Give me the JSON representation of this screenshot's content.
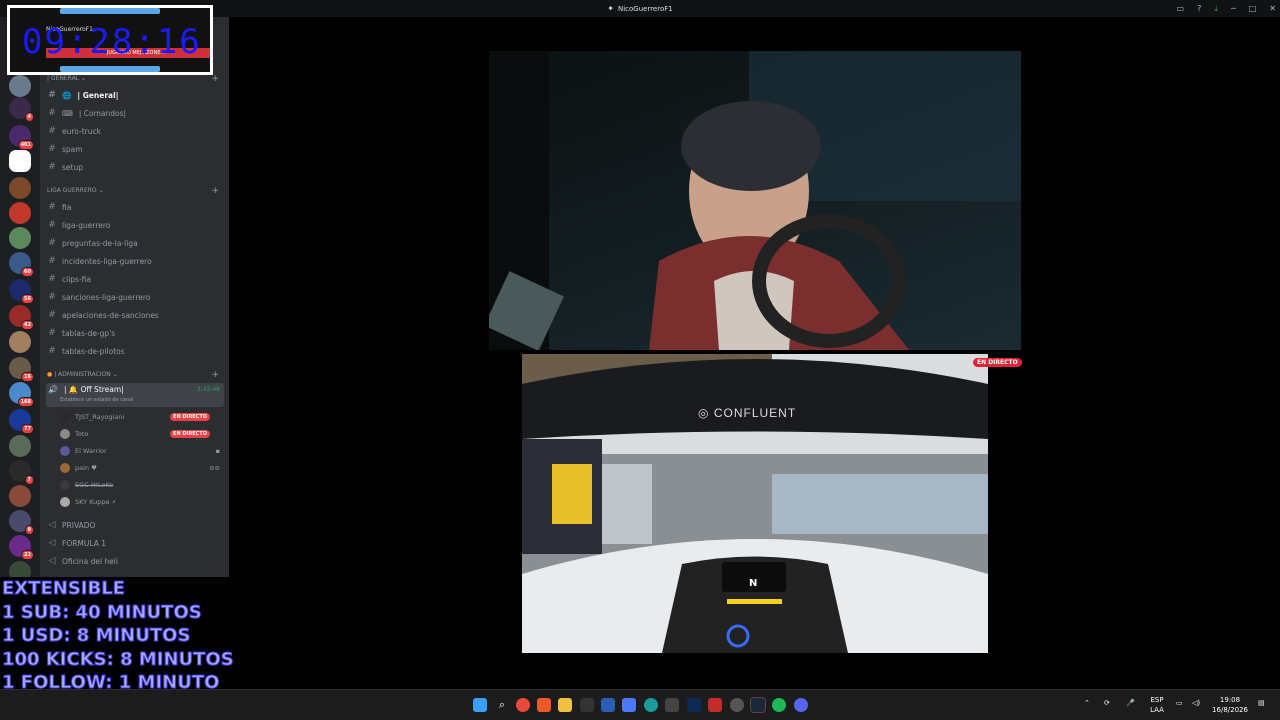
{
  "window": {
    "title": "NicoGuerreroF1"
  },
  "timer": {
    "value": "09:28:16",
    "server_name": "NicoGuerreroF1",
    "subtitle": "JUGANDO MEJ...ZONE..."
  },
  "server_badges": [
    "4",
    "401",
    "60",
    "56",
    "42",
    "16",
    "168",
    "77",
    "7",
    "9",
    "22"
  ],
  "categories": {
    "general": "| GENERAL",
    "liga": "LIGA GUERRERO",
    "admin": "| ADMINISTRACION"
  },
  "channels": {
    "general": [
      "| General|",
      "| Comandos|",
      "euro-truck",
      "spam",
      "setup"
    ],
    "liga": [
      "fia",
      "liga-guerrero",
      "preguntas-de-la-liga",
      "incidentes-liga-guerrero",
      "clips-fia",
      "sanciones-liga-guerrero",
      "apelaciones-de-sanciones",
      "tablas-de-gp's",
      "tablas-de-pilotos"
    ]
  },
  "voice": {
    "name": "| 🔔 Off Stream|",
    "duration": "3:43:48",
    "status": "Establece un estado de canal",
    "users": [
      {
        "name": "TJST_Rayogiani",
        "live": "EN DIRECTO"
      },
      {
        "name": "Toto",
        "live": "EN DIRECTO"
      },
      {
        "name": "El Warrior",
        "live": ""
      },
      {
        "name": "pain ♥",
        "live": ""
      },
      {
        "name": "SGC-HILoKo",
        "live": ""
      },
      {
        "name": "SKY Kuppe ⚡",
        "live": ""
      }
    ]
  },
  "voice_channels": [
    "PRIVADO",
    "FORMULA 1",
    "Oficina del heli"
  ],
  "overlay_lines": [
    "EXTENSIBLE",
    "1 SUB: 40 MINUTOS",
    "1 USD: 8 MINUTOS",
    "100 KICKS: 8 MINUTOS",
    "1 FOLLOW: 1 MINUTO"
  ],
  "stream": {
    "live_tag": "EN DIRECTO",
    "sponsor": "CONFLUENT",
    "gear": "N"
  },
  "taskbar": {
    "lang": "ESP",
    "layout": "LAA",
    "time": "19:08",
    "date": "16/8/2026"
  },
  "colors": {
    "discord_bg": "#2b2d31",
    "server_bg": "#1e1f22",
    "live": "#f23f43",
    "timer": "#1a1aff"
  }
}
